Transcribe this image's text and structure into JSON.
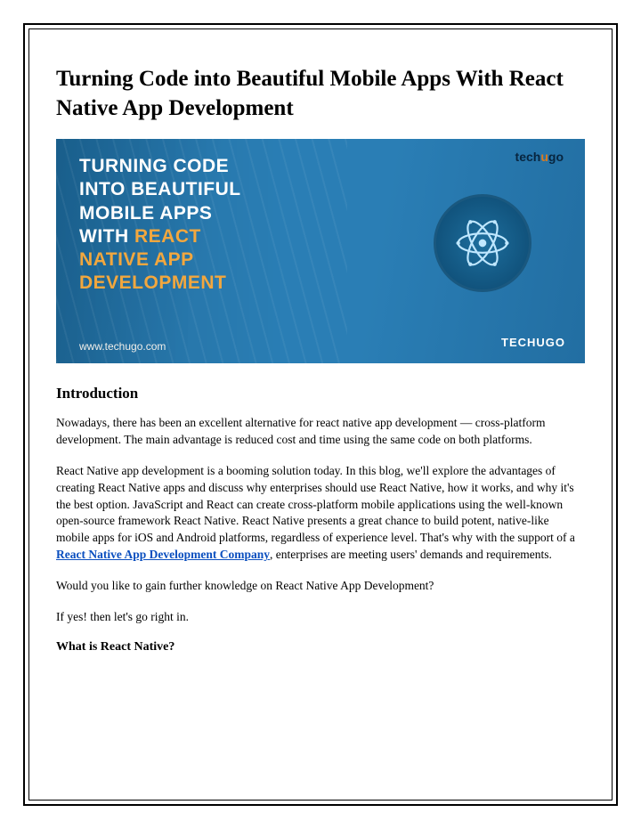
{
  "title": "Turning Code into Beautiful Mobile Apps With React Native App Development",
  "banner": {
    "line1": "TURNING CODE",
    "line2": "INTO BEAUTIFUL",
    "line3": "MOBILE APPS",
    "line4": "WITH",
    "line5a": "REACT",
    "line5b": "NATIVE APP",
    "line5c": "DEVELOPMENT",
    "url": "www.techugo.com",
    "brand": "TECHUGO",
    "logo_pre": "tech",
    "logo_u": "u",
    "logo_post": "go"
  },
  "intro": {
    "heading": "Introduction",
    "p1": "Nowadays, there has been an excellent alternative for react native app development — cross-platform development. The main advantage is reduced cost and time using the same code on both platforms.",
    "p2a": "React Native app development is a booming solution today. In this blog, we'll explore the advantages of creating React Native apps and discuss why enterprises should use React Native, how it works, and why it's the best option. JavaScript and React can create cross-platform mobile applications using the well-known open-source framework React Native. React Native presents a great chance to build potent, native-like mobile apps for iOS and Android platforms, regardless of experience level. That's why with the support of a ",
    "link": "React Native App Development Company",
    "p2b": ", enterprises are meeting users' demands and requirements.",
    "p3": "Would you like to gain further knowledge on React Native App Development?",
    "p4": "If yes! then let's go right in.",
    "sub": "What is React Native?"
  }
}
